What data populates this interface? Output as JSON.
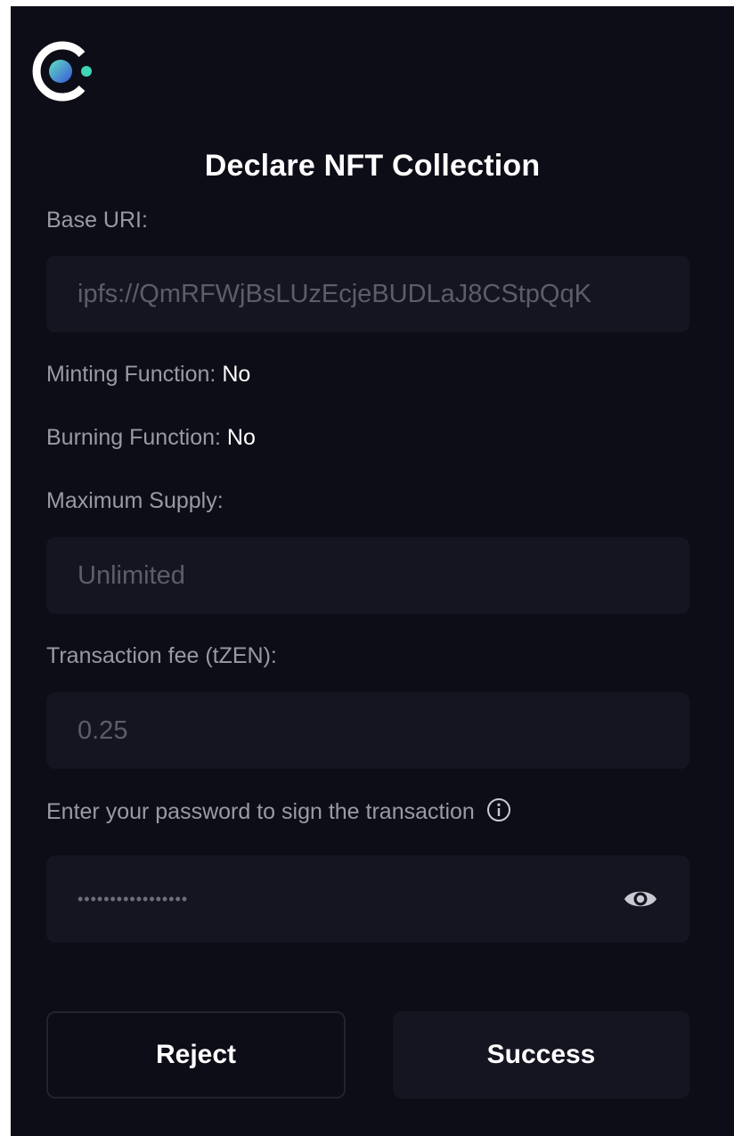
{
  "title": "Declare NFT Collection",
  "base_uri": {
    "label": "Base URI:",
    "value": "ipfs://QmRFWjBsLUzEcjeBUDLaJ8CStpQqK"
  },
  "minting": {
    "label": "Minting Function:",
    "value": "No"
  },
  "burning": {
    "label": "Burning Function:",
    "value": "No"
  },
  "max_supply": {
    "label": "Maximum Supply:",
    "value": "Unlimited"
  },
  "fee": {
    "label": "Transaction fee (tZEN):",
    "value": "0.25"
  },
  "password": {
    "label": "Enter your password to sign the transaction",
    "masked_value": "•••••••••••••••••"
  },
  "buttons": {
    "reject": "Reject",
    "success": "Success"
  },
  "icons": {
    "logo": "celo-style-logo-icon",
    "info": "info-icon",
    "eye": "eye-icon"
  },
  "colors": {
    "background": "#0d0d17",
    "field": "#151522",
    "text_primary": "#ffffff",
    "text_secondary": "#9a9aa6",
    "text_muted": "#5d5d69",
    "logo_gradient_start": "#5fe0c2",
    "logo_gradient_end": "#3a55d8"
  }
}
